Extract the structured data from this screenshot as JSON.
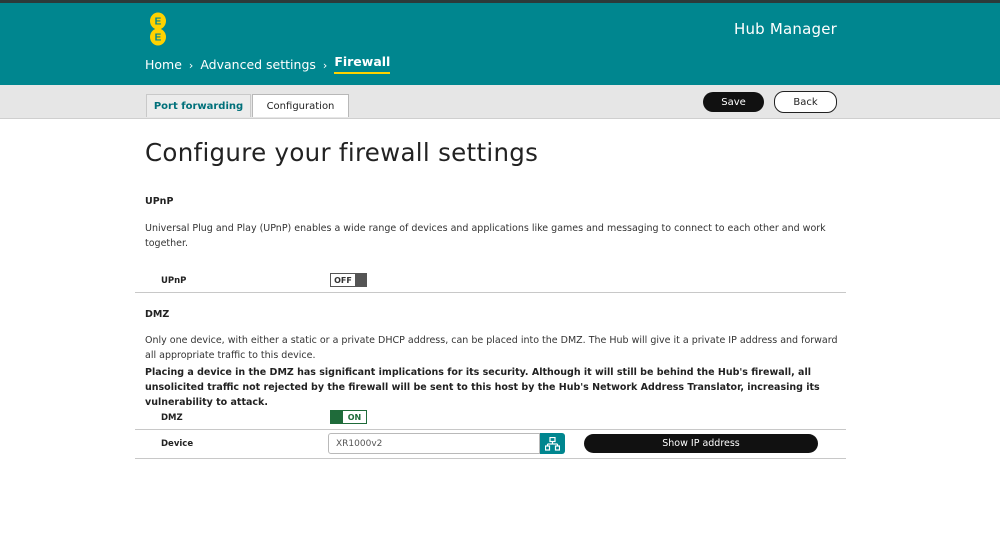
{
  "header": {
    "logo_alt": "EE",
    "app_title": "Hub Manager",
    "breadcrumb": [
      "Home",
      "Advanced settings",
      "Firewall"
    ],
    "breadcrumb_separator": "›"
  },
  "tabs": [
    {
      "label": "Port forwarding",
      "active": false
    },
    {
      "label": "Configuration",
      "active": true
    }
  ],
  "actions": {
    "save_label": "Save",
    "back_label": "Back"
  },
  "main": {
    "title": "Configure your firewall settings",
    "upnp": {
      "heading": "UPnP",
      "description": "Universal Plug and Play (UPnP) enables a wide range of devices and applications like games and messaging to connect to each other and work together.",
      "row_label": "UPnP",
      "toggle_state": "OFF"
    },
    "dmz": {
      "heading": "DMZ",
      "description": "Only one device, with either a static or a private DHCP address, can be placed into the DMZ. The Hub will give it a private IP address and forward all appropriate traffic to this device.",
      "warning": "Placing a device in the DMZ has significant implications for its security. Although it will still be behind the Hub's firewall, all unsolicited traffic not rejected by the firewall will be sent to this host by the Hub's Network Address Translator, increasing its vulnerability to attack.",
      "row_label": "DMZ",
      "toggle_state": "ON",
      "device_label": "Device",
      "device_value": "XR1000v2",
      "show_ip_label": "Show IP address"
    }
  },
  "colors": {
    "brand_teal": "#00868f",
    "accent_yellow": "#ffd200",
    "toggle_on_green": "#1f6b3a",
    "button_dark": "#111111"
  },
  "icons": {
    "logo": "ee-logo-icon",
    "device_picker": "network-tree-icon",
    "breadcrumb_separator": "chevron-right-icon"
  }
}
